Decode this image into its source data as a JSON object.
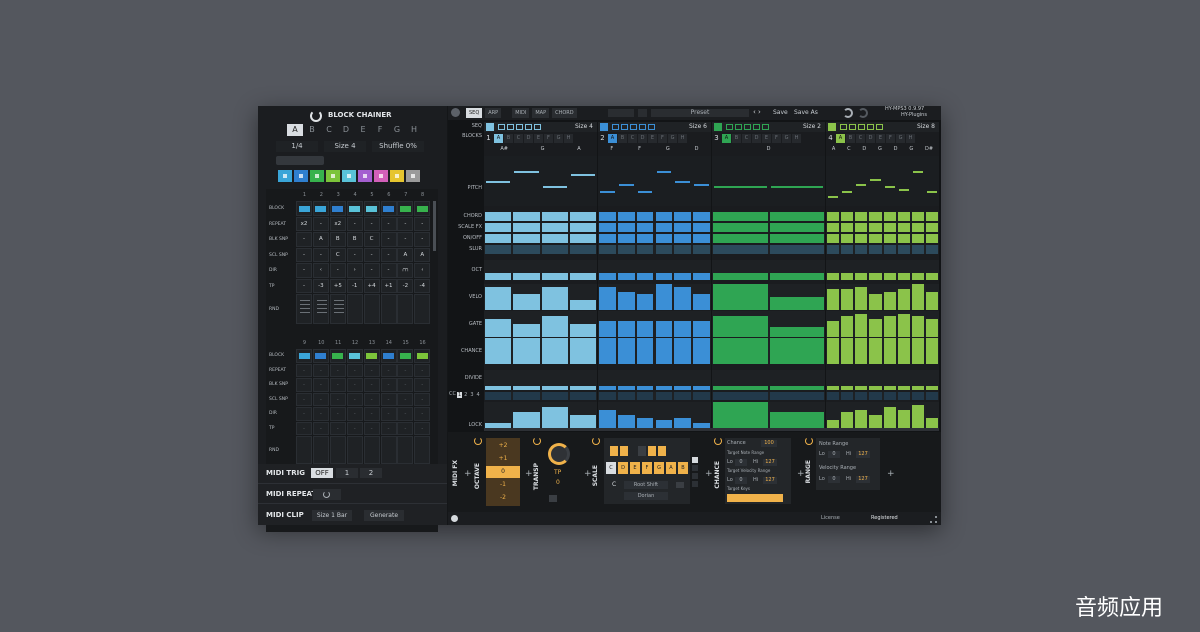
{
  "watermark": "音频应用",
  "left": {
    "title": "BLOCK CHAINER",
    "letters": [
      "A",
      "B",
      "C",
      "D",
      "E",
      "F",
      "G",
      "H"
    ],
    "rate": "1/4",
    "size": "Size 4",
    "shuffle": "Shuffle 0%",
    "colors": [
      "#3aa5d8",
      "#2f7fcf",
      "#37b24d",
      "#7cc43a",
      "#59c2d8",
      "#a45fd0",
      "#d25fb9",
      "#e6c52f",
      "#9a9a9a"
    ],
    "rows_top": [
      "BLOCK",
      "REPEAT",
      "BLK SNP",
      "SCL SNP",
      "DIR",
      "TP",
      "RND"
    ],
    "cols_top": [
      "1",
      "2",
      "3",
      "4",
      "5",
      "6",
      "7",
      "8"
    ],
    "cols_bot": [
      "9",
      "10",
      "11",
      "12",
      "13",
      "14",
      "15",
      "16"
    ],
    "rows_bot": [
      "BLOCK",
      "REPEAT",
      "BLK SNP",
      "SCL SNP",
      "DIR",
      "TP",
      "RND"
    ],
    "repeat_vals": [
      "x2",
      "-",
      "x2",
      "-",
      "-",
      "-",
      "-",
      "-"
    ],
    "blk_vals": [
      "-",
      "A",
      "B",
      "B",
      "C",
      "-",
      "-",
      "-"
    ],
    "scl_vals": [
      "-",
      "-",
      "C",
      "-",
      "-",
      "-",
      "A",
      "A"
    ],
    "dir_vals": [
      "-",
      "‹",
      "-",
      "›",
      "-",
      "-",
      "⩋",
      "‹"
    ],
    "tp_vals": [
      "-",
      "-3",
      "+5",
      "-1",
      "+4",
      "+1",
      "-2",
      "-4"
    ],
    "block_colors_top": [
      "#3aa5d8",
      "#3aa5d8",
      "#2f7fcf",
      "#59c2d8",
      "#59c2d8",
      "#2f7fcf",
      "#37b24d",
      "#37b24d"
    ],
    "block_colors_bot": [
      "#3aa5d8",
      "#2f7fcf",
      "#37b24d",
      "#59c2d8",
      "#7cc43a",
      "#2f7fcf",
      "#37b24d",
      "#7cc43a"
    ],
    "midi_trig": "MIDI TRIG",
    "off": "OFF",
    "one": "1",
    "two": "2",
    "midi_repeat": "MIDI REPEAT",
    "midi_clip": "MIDI CLIP",
    "size_bar": "Size 1 Bar",
    "generate": "Generate"
  },
  "top": {
    "tabs": [
      "SEQ",
      "ARP",
      "MIDI",
      "MAP",
      "CHORD"
    ],
    "preset": "Preset",
    "save": "Save",
    "save_as": "Save As",
    "brand1": "HY-MPS3 0.9.97",
    "brand2": "HY-Plugins"
  },
  "seq": {
    "row_labels": [
      "SEQ",
      "BLOCKS",
      "PITCH",
      "CHORD",
      "SCALE FX",
      "ON/OFF",
      "SLUR",
      "OCT",
      "VELO",
      "GATE",
      "CHANCE",
      "DIVIDE",
      "LOCK"
    ],
    "blocks": [
      {
        "num": "1",
        "size": "Size 4",
        "color": "#7fc2e0",
        "notes": [
          "A#",
          "G",
          "A"
        ]
      },
      {
        "num": "2",
        "size": "Size 6",
        "color": "#3b8fd6",
        "notes": [
          "F",
          "F",
          "G",
          "D"
        ]
      },
      {
        "num": "3",
        "size": "Size 2",
        "color": "#2fa553",
        "notes": [
          "D"
        ]
      },
      {
        "num": "4",
        "size": "Size 8",
        "color": "#8bc34a",
        "notes": [
          "A",
          "C",
          "D",
          "G",
          "D",
          "G",
          "D#"
        ]
      }
    ],
    "letters": [
      "A",
      "B",
      "C",
      "D",
      "E",
      "F",
      "G",
      "H"
    ],
    "cc": "CC",
    "cc_nums": [
      "1",
      "2",
      "3",
      "4"
    ]
  },
  "fx": {
    "title": "MIDI FX",
    "octave": "OCTAVE",
    "oct_vals": [
      "+2",
      "+1",
      "0",
      "-1",
      "-2"
    ],
    "transp": "TRANSP",
    "tp": "TP",
    "tp_val": "0",
    "scale": "SCALE",
    "root": "Root Shift",
    "mode": "Dorian",
    "c": "C",
    "keys": [
      "C",
      "D",
      "E",
      "F",
      "G",
      "A",
      "B"
    ],
    "chance": "CHANCE",
    "chance_lbl": "Chance",
    "chance_val": "100",
    "tnr": "Target Note Range",
    "tvr": "Target Velocity Range",
    "tk": "Target Keys",
    "lo": "Lo",
    "hi": "Hi",
    "zero": "0",
    "max": "127",
    "range": "RANGE",
    "nr": "Note Range",
    "vr": "Velocity Range"
  },
  "status": {
    "license": "License",
    "registered": "Registered"
  }
}
